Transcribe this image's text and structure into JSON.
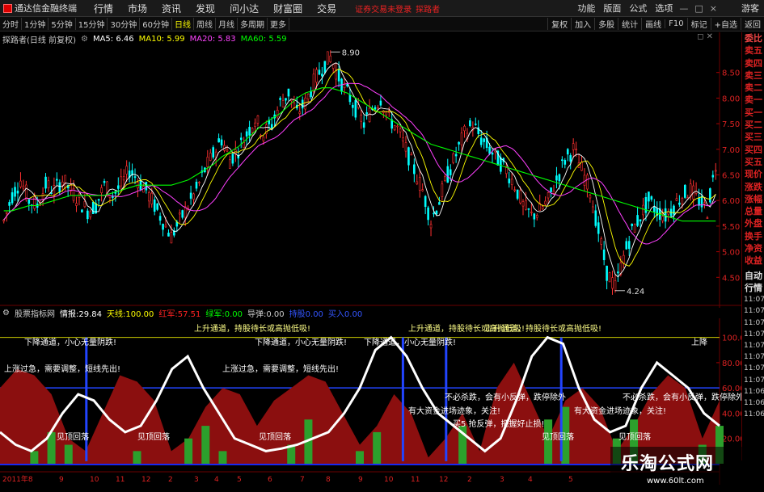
{
  "menubar": {
    "app_title": "通达信金融终端",
    "menus": [
      "行情",
      "市场",
      "资讯",
      "发现",
      "问小达",
      "财富圈",
      "交易"
    ],
    "login_status": "证券交易未登录",
    "user": "探路者",
    "right_menus": [
      "功能",
      "版面",
      "公式",
      "选项"
    ],
    "guest": "游客"
  },
  "toolbar": {
    "periods": [
      "分时",
      "1分钟",
      "5分钟",
      "15分钟",
      "30分钟",
      "60分钟",
      "日线",
      "周线",
      "月线",
      "多周期",
      "更多"
    ],
    "active": "日线",
    "right_buttons": [
      "复权",
      "加入",
      "多股",
      "统计",
      "画线",
      "F10",
      "标记",
      "+自选",
      "返回"
    ]
  },
  "stock": {
    "name": "探路者(日线 前复权)",
    "ma5_label": "MA5: 6.46",
    "ma10_label": "MA10: 5.99",
    "ma20_label": "MA20: 5.83",
    "ma60_label": "MA60: 5.59",
    "colors": {
      "ma5": "#ffffff",
      "ma10": "#ffff00",
      "ma20": "#ff40ff",
      "ma60": "#00ff00"
    }
  },
  "indicator": {
    "name": "股票指标网",
    "fields": [
      {
        "label": "情报:",
        "value": "29.84",
        "color": "#ffffff"
      },
      {
        "label": "天线:",
        "value": "100.00",
        "color": "#ffff00"
      },
      {
        "label": "红军:",
        "value": "57.51",
        "color": "#ff2020"
      },
      {
        "label": "绿军:",
        "value": "0.00",
        "color": "#00ff00"
      },
      {
        "label": "导弹:",
        "value": "0.00",
        "color": "#cccccc"
      },
      {
        "label": "持股",
        "value": "0.00",
        "color": "#3355ff"
      },
      {
        "label": "买入",
        "value": "0.00",
        "color": "#3355ff"
      }
    ],
    "texts": {
      "up_channel": "上升通道，持股待长或高抛低吸!",
      "down_channel": "下降通道，小心无量阴跌!",
      "rise_adjust": "上涨过急，需要调整，短线先出!",
      "callback": "见顶回落",
      "no_kill": "不必杀跌，会有小反弹，跌停除外",
      "main_force": "有大资金进场迹象，关注!",
      "bounce": "买5 抢反弹，把握好止损!",
      "short_top": "上降"
    }
  },
  "sidebar": {
    "quote_items": [
      "委比",
      "卖五",
      "卖四",
      "卖三",
      "卖二",
      "卖一",
      "买一",
      "买二",
      "买三",
      "买四",
      "买五",
      "现价",
      "涨跌",
      "涨幅",
      "总量",
      "外盘",
      "换手",
      "净资",
      "收益"
    ],
    "active_index": 0,
    "tabs": [
      "自动",
      "行情"
    ],
    "times": [
      "11:07",
      "11:07",
      "11:07",
      "11:07",
      "11:07",
      "11:07",
      "11:07",
      "11:07",
      "11:06",
      "11:06",
      "11:06"
    ]
  },
  "chart_data": [
    {
      "type": "candlestick",
      "title": "探路者(日线 前复权)",
      "y_ticks": [
        4.5,
        5.0,
        5.5,
        6.0,
        6.5,
        7.0,
        7.5,
        8.0,
        8.5
      ],
      "ylim": [
        4.0,
        9.0
      ],
      "high_marker": {
        "label": "8.90",
        "value": 8.9
      },
      "low_marker": {
        "label": "4.24",
        "value": 4.24
      },
      "trend": [
        5.6,
        6.1,
        6.4,
        6.0,
        5.9,
        6.3,
        6.2,
        6.4,
        6.2,
        6.0,
        5.8,
        5.9,
        6.3,
        6.1,
        6.3,
        6.6,
        6.4,
        6.2,
        5.9,
        5.6,
        5.3,
        5.6,
        5.9,
        6.2,
        6.6,
        6.9,
        7.2,
        6.8,
        7.0,
        7.3,
        7.6,
        7.3,
        7.5,
        7.9,
        8.1,
        7.7,
        7.9,
        8.3,
        8.6,
        8.8,
        8.4,
        8.1,
        7.8,
        7.5,
        7.8,
        8.0,
        7.6,
        7.4,
        7.0,
        6.6,
        6.2,
        5.6,
        6.0,
        6.5,
        6.9,
        7.3,
        7.5,
        7.2,
        7.0,
        6.8,
        6.6,
        6.3,
        5.9,
        5.7,
        5.8,
        6.0,
        6.4,
        6.8,
        7.0,
        6.6,
        6.2,
        5.4,
        4.6,
        4.3,
        4.9,
        5.4,
        5.7,
        6.0,
        5.8,
        5.7,
        5.9,
        6.1,
        6.2,
        6.0,
        5.8,
        6.7
      ],
      "ma60": [
        5.8,
        5.8,
        5.85,
        5.9,
        5.9,
        5.95,
        6.0,
        6.05,
        6.1,
        6.1,
        6.1,
        6.1,
        6.1,
        6.15,
        6.2,
        6.25,
        6.3,
        6.3,
        6.3,
        6.3,
        6.3,
        6.35,
        6.4,
        6.5,
        6.6,
        6.7,
        6.85,
        6.95,
        7.05,
        7.2,
        7.35,
        7.5,
        7.6,
        7.7,
        7.85,
        8.0,
        8.1,
        8.15,
        8.2,
        8.2,
        8.15,
        8.1,
        8.0,
        7.9,
        7.8,
        7.7,
        7.6,
        7.5,
        7.4,
        7.3,
        7.2,
        7.1,
        7.05,
        7.0,
        6.95,
        6.9,
        6.85,
        6.8,
        6.75,
        6.7,
        6.65,
        6.6,
        6.55,
        6.5,
        6.45,
        6.4,
        6.35,
        6.3,
        6.25,
        6.2,
        6.15,
        6.1,
        6.05,
        6.0,
        5.95,
        5.9,
        5.85,
        5.8,
        5.75,
        5.7,
        5.65,
        5.6,
        5.6,
        5.6,
        5.6,
        5.6
      ]
    },
    {
      "type": "area",
      "title": "股票指标网",
      "y_ticks": [
        20,
        40,
        60,
        80,
        100
      ],
      "ylim": [
        0,
        110
      ],
      "x_labels": [
        "2011年8",
        "9",
        "10",
        "11",
        "12",
        "2",
        "3",
        "4",
        "5",
        "6",
        "7",
        "8",
        "9",
        "10",
        "11",
        "12",
        "2",
        "3",
        "4",
        "5"
      ],
      "red_army": [
        60,
        75,
        70,
        55,
        20,
        10,
        40,
        70,
        65,
        50,
        10,
        20,
        45,
        60,
        55,
        30,
        50,
        60,
        70,
        65,
        40,
        15,
        30,
        55,
        40,
        5,
        20,
        40,
        10,
        60,
        80,
        50,
        20,
        50,
        60,
        45,
        10,
        30,
        55,
        70,
        60,
        20,
        50
      ],
      "green_army": [
        0,
        0,
        10,
        25,
        15,
        0,
        0,
        0,
        10,
        0,
        0,
        20,
        30,
        10,
        0,
        0,
        0,
        15,
        35,
        0,
        0,
        10,
        25,
        0,
        0,
        0,
        0,
        30,
        0,
        0,
        0,
        0,
        35,
        45,
        0,
        0,
        20,
        35,
        0,
        0,
        0,
        15,
        30
      ],
      "intel_line": [
        25,
        15,
        10,
        20,
        40,
        55,
        50,
        35,
        25,
        30,
        50,
        75,
        85,
        60,
        40,
        20,
        15,
        10,
        12,
        15,
        20,
        25,
        40,
        60,
        90,
        100,
        85,
        60,
        40,
        30,
        20,
        10,
        20,
        50,
        85,
        100,
        95,
        60,
        35,
        25,
        30,
        60,
        80,
        70,
        60,
        40,
        30
      ]
    }
  ],
  "watermark": {
    "text1": "乐淘公式网",
    "text2": "www.60lt.com"
  }
}
